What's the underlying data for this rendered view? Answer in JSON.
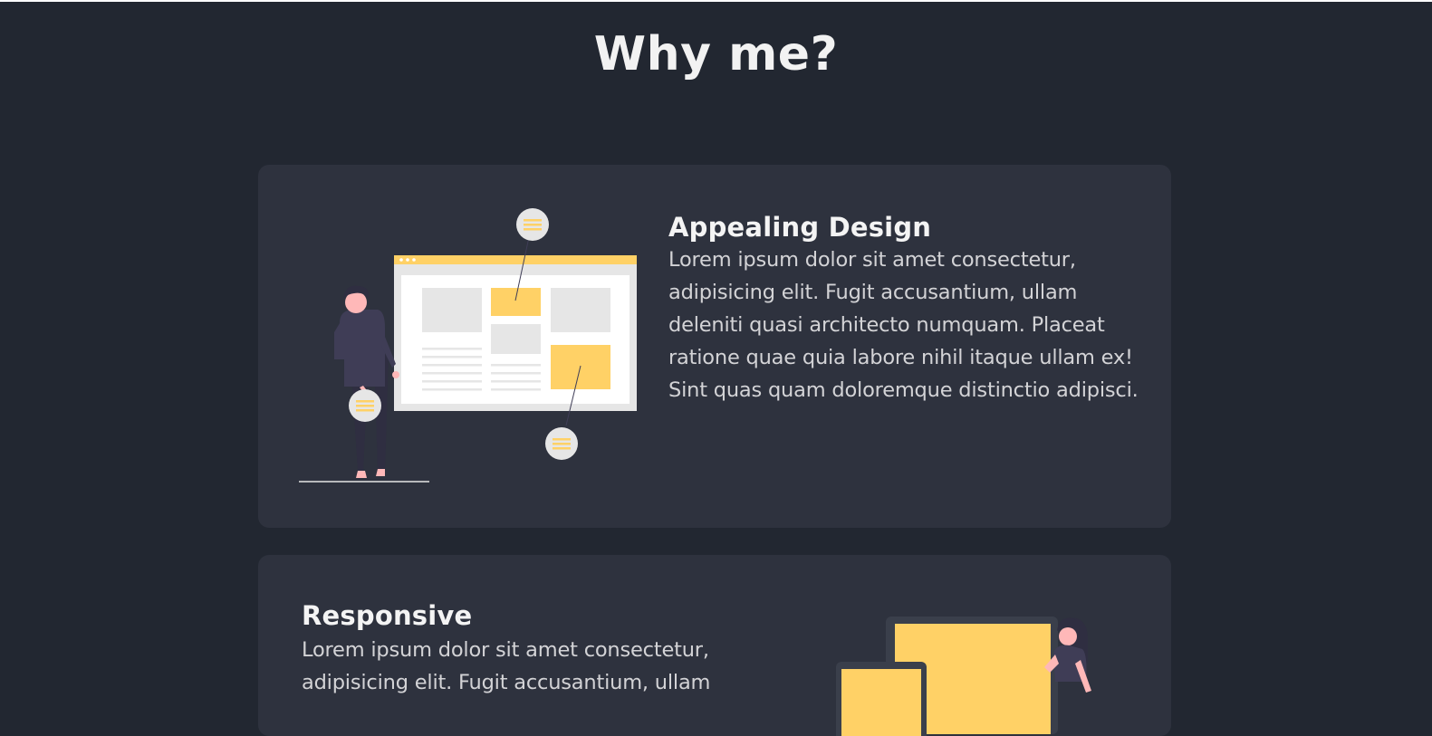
{
  "page": {
    "title": "Why me?"
  },
  "colors": {
    "background": "#222731",
    "card": "#2e323e",
    "accent": "#ffd166",
    "text": "#eeeeee"
  },
  "features": [
    {
      "title": "Appealing Design",
      "text": "Lorem ipsum dolor sit amet consectetur, adipisicing elit. Fugit accusantium, ullam deleniti quasi architecto numquam. Placeat ratione quae quia labore nihil itaque ullam ex! Sint quas quam doloremque distinctio adipisci.",
      "illustration": "designer-with-browser-wireframe"
    },
    {
      "title": "Responsive",
      "text": "Lorem ipsum dolor sit amet consectetur, adipisicing elit. Fugit accusantium, ullam",
      "illustration": "person-with-devices"
    }
  ]
}
